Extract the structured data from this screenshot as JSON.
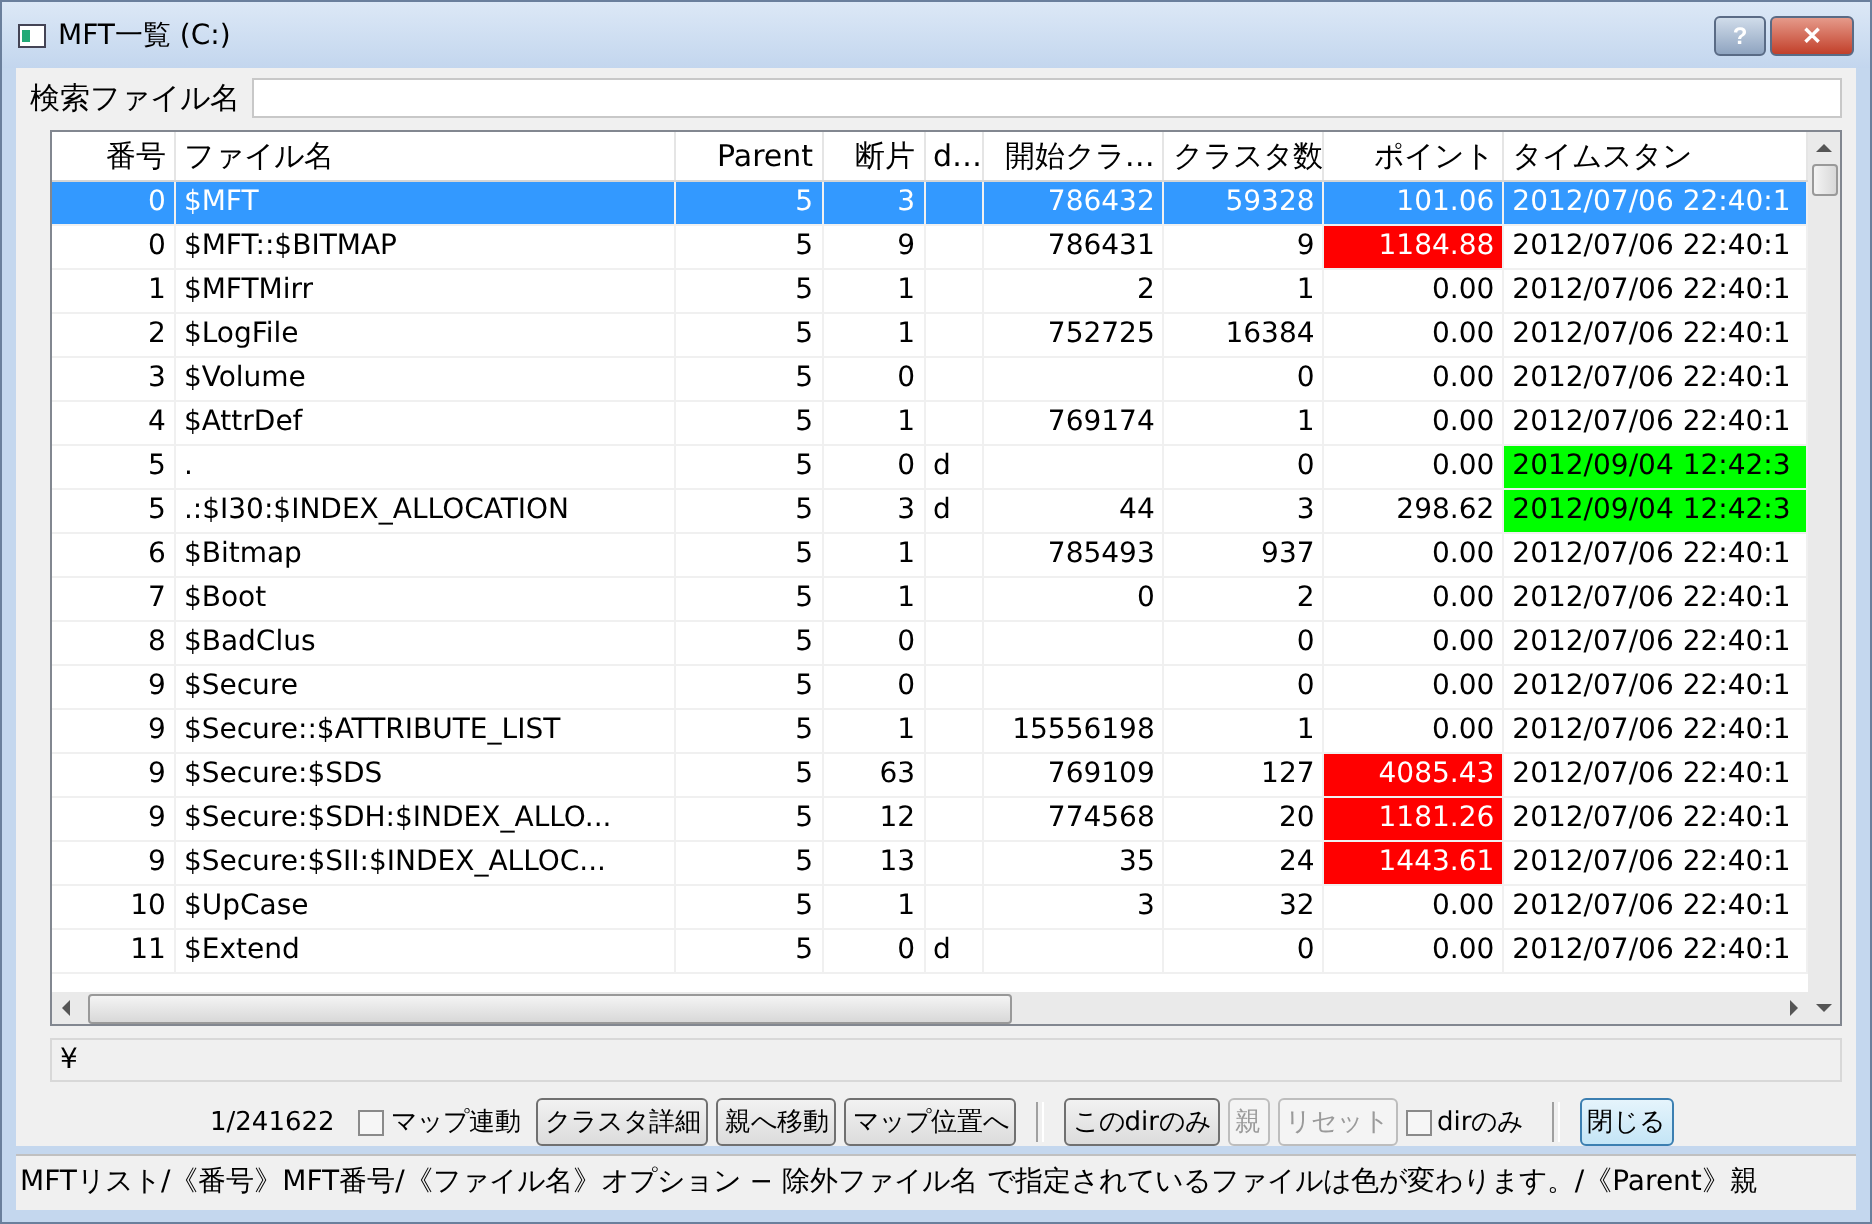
{
  "window": {
    "title": "MFT一覧 (C:)",
    "buttons": [
      "?",
      "✕"
    ]
  },
  "search": {
    "label": "検索ファイル名"
  },
  "table": {
    "columns": [
      "番号",
      "ファイル名",
      "Parent",
      "断片",
      "d…",
      "開始クラ…",
      "クラスタ数",
      "ポイント",
      "タイムスタン"
    ],
    "rows": [
      {
        "selected": true,
        "no": "0",
        "name": "$MFT",
        "parent": "5",
        "frag": "3",
        "d": "",
        "start": "786432",
        "clusters": "59328",
        "point": {
          "text": "101.06"
        },
        "time": {
          "text": "2012/07/06 22:40:1"
        }
      },
      {
        "selected": false,
        "no": "0",
        "name": "$MFT::$BITMAP",
        "parent": "5",
        "frag": "9",
        "d": "",
        "start": "786431",
        "clusters": "9",
        "point": {
          "text": "1184.88",
          "color": "#ff0000"
        },
        "time": {
          "text": "2012/07/06 22:40:1"
        }
      },
      {
        "selected": false,
        "no": "1",
        "name": "$MFTMirr",
        "parent": "5",
        "frag": "1",
        "d": "",
        "start": "2",
        "clusters": "1",
        "point": {
          "text": "0.00"
        },
        "time": {
          "text": "2012/07/06 22:40:1"
        }
      },
      {
        "selected": false,
        "no": "2",
        "name": "$LogFile",
        "parent": "5",
        "frag": "1",
        "d": "",
        "start": "752725",
        "clusters": "16384",
        "point": {
          "text": "0.00"
        },
        "time": {
          "text": "2012/07/06 22:40:1"
        }
      },
      {
        "selected": false,
        "no": "3",
        "name": "$Volume",
        "parent": "5",
        "frag": "0",
        "d": "",
        "start": "",
        "clusters": "0",
        "point": {
          "text": "0.00"
        },
        "time": {
          "text": "2012/07/06 22:40:1"
        }
      },
      {
        "selected": false,
        "no": "4",
        "name": "$AttrDef",
        "parent": "5",
        "frag": "1",
        "d": "",
        "start": "769174",
        "clusters": "1",
        "point": {
          "text": "0.00"
        },
        "time": {
          "text": "2012/07/06 22:40:1"
        }
      },
      {
        "selected": false,
        "no": "5",
        "name": ".",
        "parent": "5",
        "frag": "0",
        "d": "d",
        "start": "",
        "clusters": "0",
        "point": {
          "text": "0.00"
        },
        "time": {
          "text": "2012/09/04 12:42:3",
          "color": "#00ff00"
        }
      },
      {
        "selected": false,
        "no": "5",
        "name": ".:$I30:$INDEX_ALLOCATION",
        "parent": "5",
        "frag": "3",
        "d": "d",
        "start": "44",
        "clusters": "3",
        "point": {
          "text": "298.62"
        },
        "time": {
          "text": "2012/09/04 12:42:3",
          "color": "#00ff00"
        }
      },
      {
        "selected": false,
        "no": "6",
        "name": "$Bitmap",
        "parent": "5",
        "frag": "1",
        "d": "",
        "start": "785493",
        "clusters": "937",
        "point": {
          "text": "0.00"
        },
        "time": {
          "text": "2012/07/06 22:40:1"
        }
      },
      {
        "selected": false,
        "no": "7",
        "name": "$Boot",
        "parent": "5",
        "frag": "1",
        "d": "",
        "start": "0",
        "clusters": "2",
        "point": {
          "text": "0.00"
        },
        "time": {
          "text": "2012/07/06 22:40:1"
        }
      },
      {
        "selected": false,
        "no": "8",
        "name": "$BadClus",
        "parent": "5",
        "frag": "0",
        "d": "",
        "start": "",
        "clusters": "0",
        "point": {
          "text": "0.00"
        },
        "time": {
          "text": "2012/07/06 22:40:1"
        }
      },
      {
        "selected": false,
        "no": "9",
        "name": "$Secure",
        "parent": "5",
        "frag": "0",
        "d": "",
        "start": "",
        "clusters": "0",
        "point": {
          "text": "0.00"
        },
        "time": {
          "text": "2012/07/06 22:40:1"
        }
      },
      {
        "selected": false,
        "no": "9",
        "name": "$Secure::$ATTRIBUTE_LIST",
        "parent": "5",
        "frag": "1",
        "d": "",
        "start": "15556198",
        "clusters": "1",
        "point": {
          "text": "0.00"
        },
        "time": {
          "text": "2012/07/06 22:40:1"
        }
      },
      {
        "selected": false,
        "no": "9",
        "name": "$Secure:$SDS",
        "parent": "5",
        "frag": "63",
        "d": "",
        "start": "769109",
        "clusters": "127",
        "point": {
          "text": "4085.43",
          "color": "#ff0000"
        },
        "time": {
          "text": "2012/07/06 22:40:1"
        }
      },
      {
        "selected": false,
        "no": "9",
        "name": "$Secure:$SDH:$INDEX_ALLO...",
        "parent": "5",
        "frag": "12",
        "d": "",
        "start": "774568",
        "clusters": "20",
        "point": {
          "text": "1181.26",
          "color": "#ff0000"
        },
        "time": {
          "text": "2012/07/06 22:40:1"
        }
      },
      {
        "selected": false,
        "no": "9",
        "name": "$Secure:$SII:$INDEX_ALLOC...",
        "parent": "5",
        "frag": "13",
        "d": "",
        "start": "35",
        "clusters": "24",
        "point": {
          "text": "1443.61",
          "color": "#ff0000"
        },
        "time": {
          "text": "2012/07/06 22:40:1"
        }
      },
      {
        "selected": false,
        "no": "10",
        "name": "$UpCase",
        "parent": "5",
        "frag": "1",
        "d": "",
        "start": "3",
        "clusters": "32",
        "point": {
          "text": "0.00"
        },
        "time": {
          "text": "2012/07/06 22:40:1"
        }
      },
      {
        "selected": false,
        "no": "11",
        "name": "$Extend",
        "parent": "5",
        "frag": "0",
        "d": "d",
        "start": "",
        "clusters": "0",
        "point": {
          "text": "0.00"
        },
        "time": {
          "text": "2012/07/06 22:40:1"
        }
      }
    ]
  },
  "path": {
    "value": "¥"
  },
  "controls": [
    {
      "kind": "text",
      "label": "1/241622"
    },
    {
      "kind": "checkbox",
      "label": "マップ連動",
      "checked": false
    },
    {
      "kind": "button",
      "label": "クラスタ詳細",
      "disabled": false
    },
    {
      "kind": "button",
      "label": "親へ移動",
      "disabled": false
    },
    {
      "kind": "button",
      "label": "マップ位置へ",
      "disabled": false
    },
    {
      "kind": "separator"
    },
    {
      "kind": "button",
      "label": "このdirのみ",
      "disabled": false
    },
    {
      "kind": "button",
      "label": "親",
      "disabled": true
    },
    {
      "kind": "button",
      "label": "リセット",
      "disabled": true
    },
    {
      "kind": "checkbox",
      "label": "dirのみ",
      "checked": false
    },
    {
      "kind": "separator"
    },
    {
      "kind": "button",
      "label": "閉じる",
      "disabled": false,
      "default": true
    }
  ],
  "status_bar": "MFTリスト/《番号》MFT番号/《ファイル名》オプション − 除外ファイル名 で指定されているファイルは色が変わります。/《Parent》親"
}
